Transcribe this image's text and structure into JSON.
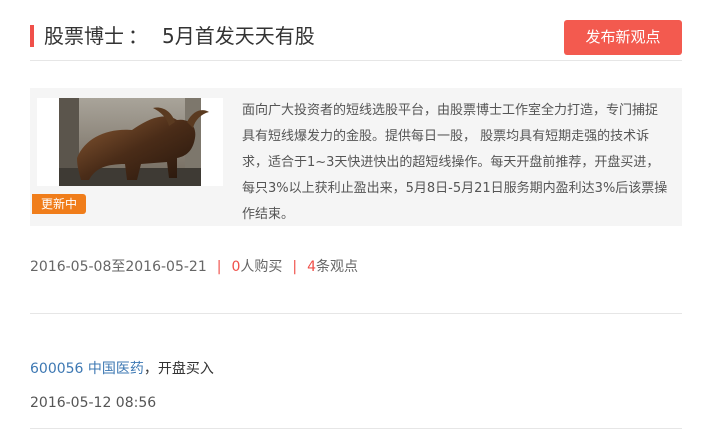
{
  "header": {
    "title": "股票博士",
    "separator": "：",
    "subtitle": "5月首发天天有股",
    "publish_button": "发布新观点"
  },
  "product": {
    "badge": "更新中",
    "image_alt": "bull-statue",
    "description": "面向广大投资者的短线选股平台，由股票博士工作室全力打造，专门捕捉具有短线爆发力的金股。提供每日一股， 股票均具有短期走强的技术诉求，适合于1~3天快进快出的超短线操作。每天开盘前推荐，开盘买进，每只3%以上获利止盈出来，5月8日-5月21日服务期内盈利达3%后该票操作结束。"
  },
  "meta": {
    "date_range": "2016-05-08至2016-05-21",
    "pipe": "|",
    "buyers_count": "0",
    "buyers_suffix": "人购买",
    "views_count": "4",
    "views_suffix": "条观点"
  },
  "viewpoint": {
    "stock_code": "600056",
    "stock_name": "中国医药",
    "action": "，开盘买入",
    "time": "2016-05-12 08:56"
  },
  "colors": {
    "accent": "#f0504a",
    "badge": "#f07d1a",
    "link": "#3d78b3",
    "card_bg": "#f5f5f5"
  }
}
